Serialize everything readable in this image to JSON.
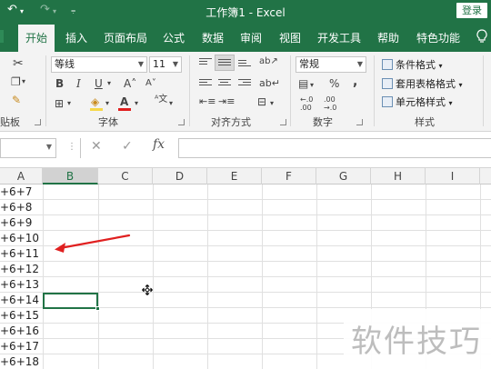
{
  "titlebar": {
    "title": "工作簿1 - Excel",
    "login_label": "登录",
    "undo_glyph": "↶",
    "redo_glyph": "↷"
  },
  "tabs": [
    "开始",
    "插入",
    "页面布局",
    "公式",
    "数据",
    "审阅",
    "视图",
    "开发工具",
    "帮助",
    "特色功能"
  ],
  "active_tab": "开始",
  "ribbon": {
    "font_name": "等线",
    "font_size": "11",
    "number_format": "常规",
    "styles_items": [
      "条件格式",
      "套用表格格式",
      "单元格样式"
    ],
    "group_labels": {
      "clipboard": "贴板",
      "font": "字体",
      "alignment": "对齐方式",
      "number": "数字",
      "styles": "样式"
    },
    "bold": "B",
    "italic": "I",
    "underline": "U",
    "percent": "%",
    "comma": ","
  },
  "formula_bar": {
    "cancel_glyph": "✕",
    "enter_glyph": "✓",
    "fx_label": "fx"
  },
  "grid": {
    "columns": [
      "A",
      "B",
      "C",
      "D",
      "E",
      "F",
      "G",
      "H",
      "I"
    ],
    "selected_column": "B",
    "column_a_values": [
      "+6+7",
      "+6+8",
      "+6+9",
      "+6+10",
      "+6+11",
      "+6+12",
      "+6+13",
      "+6+14",
      "+6+15",
      "+6+16",
      "+6+17",
      "+6+18"
    ]
  },
  "annotation": {
    "arrow_color": "#e02020"
  },
  "watermark": "软件技巧",
  "colors": {
    "excel_green": "#217346",
    "ribbon_bg": "#f3f3f3"
  }
}
